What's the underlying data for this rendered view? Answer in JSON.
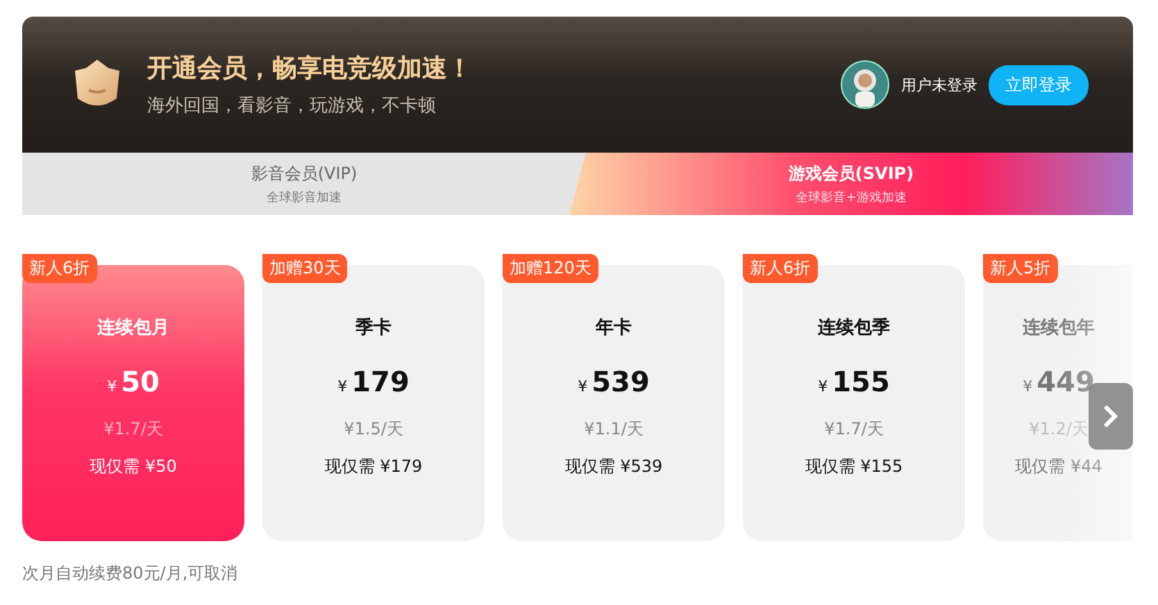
{
  "header": {
    "title": "开通会员，畅享电竞级加速！",
    "subtitle": "海外回国，看影音，玩游戏，不卡顿",
    "user": "用户未登录",
    "login_button": "立即登录"
  },
  "tabs": [
    {
      "label": "影音会员(VIP)",
      "sub": "全球影音加速",
      "selected": false
    },
    {
      "label": "游戏会员(SVIP)",
      "sub": "全球影音+游戏加速",
      "selected": true
    }
  ],
  "plans": [
    {
      "badge": "新人6折",
      "name": "连续包月",
      "currency": "¥",
      "price": "50",
      "per_day": "¥1.7/天",
      "now": "现仅需 ¥50",
      "selected": true
    },
    {
      "badge": "加赠30天",
      "name": "季卡",
      "currency": "¥",
      "price": "179",
      "per_day": "¥1.5/天",
      "now": "现仅需 ¥179",
      "selected": false
    },
    {
      "badge": "加赠120天",
      "name": "年卡",
      "currency": "¥",
      "price": "539",
      "per_day": "¥1.1/天",
      "now": "现仅需 ¥539",
      "selected": false
    },
    {
      "badge": "新人6折",
      "name": "连续包季",
      "currency": "¥",
      "price": "155",
      "per_day": "¥1.7/天",
      "now": "现仅需 ¥155",
      "selected": false
    },
    {
      "badge": "新人5折",
      "name": "连续包年",
      "currency": "¥",
      "price": "449",
      "per_day": "¥1.2/天",
      "now": "现仅需 ¥44",
      "selected": false
    }
  ],
  "footnote": "次月自动续费80元/月,可取消"
}
